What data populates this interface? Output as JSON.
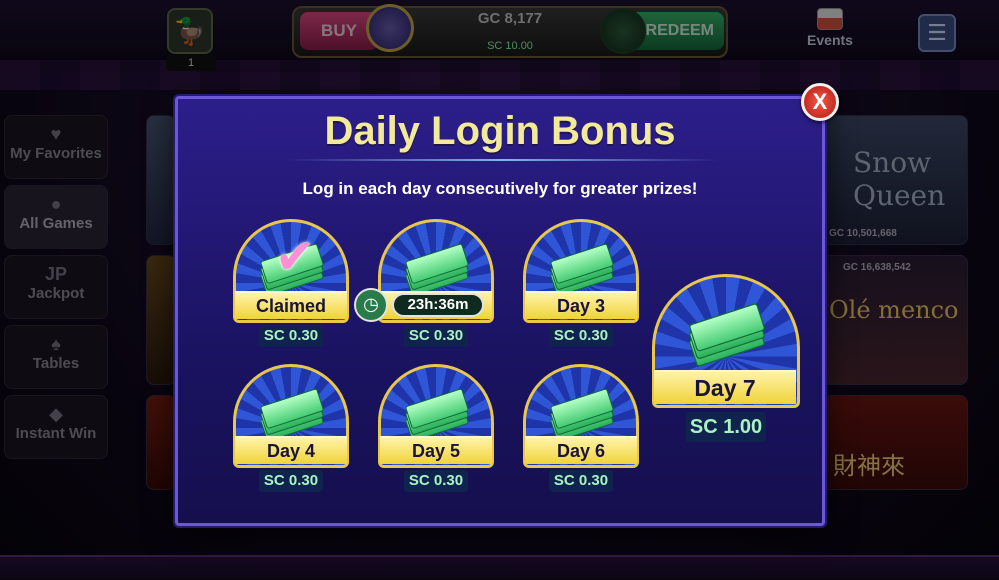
{
  "header": {
    "duck_count": "1",
    "buy_label": "BUY",
    "gc_balance": "GC 8,177",
    "sc_balance": "SC 10.00",
    "redeem_label": "REDEEM",
    "events_label": "Events",
    "menu_icon": "hamburger-icon"
  },
  "sidebar": {
    "items": [
      {
        "label": "My Favorites",
        "icon": "heart-icon"
      },
      {
        "label": "All Games",
        "icon": "coins-icon"
      },
      {
        "label": "Jackpot",
        "icon": "jp-icon"
      },
      {
        "label": "Tables",
        "icon": "cards-icon"
      },
      {
        "label": "Instant Win",
        "icon": "diamond-icon"
      }
    ]
  },
  "tiles": {
    "snow_queen_title": "Snow Queen",
    "snow_queen_jackpot": "GC 10,501,668",
    "flamenco_jackpot": "GC 16,638,542",
    "flamenco_title": "Olé menco",
    "caishen_title": "財神來"
  },
  "modal": {
    "title": "Daily Login Bonus",
    "subtitle": "Log in each day consecutively for greater prizes!",
    "close_label": "X",
    "days": [
      {
        "label": "Claimed",
        "value": "SC 0.30",
        "state": "claimed"
      },
      {
        "label": "23h:36m",
        "value": "SC 0.30",
        "state": "timer"
      },
      {
        "label": "Day 3",
        "value": "SC 0.30",
        "state": "locked"
      },
      {
        "label": "Day 4",
        "value": "SC 0.30",
        "state": "locked"
      },
      {
        "label": "Day 5",
        "value": "SC 0.30",
        "state": "locked"
      },
      {
        "label": "Day 6",
        "value": "SC 0.30",
        "state": "locked"
      },
      {
        "label": "Day 7",
        "value": "SC 1.00",
        "state": "grand"
      }
    ]
  },
  "colors": {
    "modal_bg": "#1a1361",
    "title": "#f2ea9a",
    "banner": "#f0d33a",
    "value_text": "#a9f3c2",
    "close": "#d9251a"
  }
}
